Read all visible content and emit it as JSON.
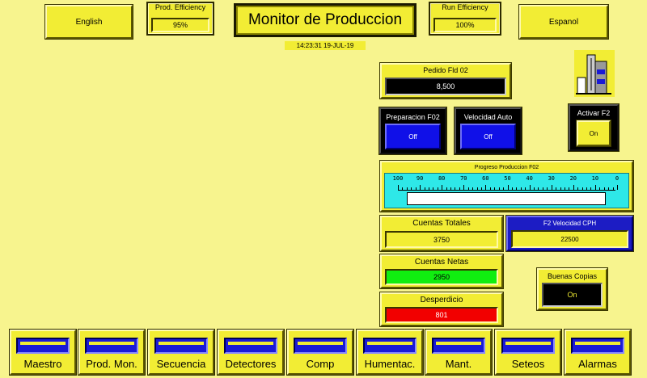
{
  "header": {
    "title": "Monitor de Produccion",
    "timestamp": "14:23:31 19-JUL-19",
    "english_label": "English",
    "espanol_label": "Espanol",
    "prod_efficiency": {
      "label": "Prod. Efficiency",
      "value": "95%"
    },
    "run_efficiency": {
      "label": "Run Efficiency",
      "value": "100%"
    }
  },
  "pedido": {
    "label": "Pedido Fld 02",
    "value": "8,500"
  },
  "preparacion": {
    "label": "Preparacion F02",
    "value": "Off"
  },
  "velocidad_auto": {
    "label": "Velocidad Auto",
    "value": "Off"
  },
  "activar": {
    "label": "Activar F2",
    "value": "On"
  },
  "progreso": {
    "label": "Progreso Produccion F02",
    "scale": [
      "100",
      "90",
      "80",
      "70",
      "60",
      "50",
      "40",
      "30",
      "20",
      "10",
      "0"
    ],
    "progress_fraction": 0
  },
  "cuentas_totales": {
    "label": "Cuentas Totales",
    "value": "3750"
  },
  "velocidad_cph": {
    "label": "F2 Velocidad CPH",
    "value": "22500"
  },
  "cuentas_netas": {
    "label": "Cuentas Netas",
    "value": "2950"
  },
  "desperdicio": {
    "label": "Desperdicio",
    "value": "801"
  },
  "buenas_copias": {
    "label": "Buenas Copias",
    "value": "On"
  },
  "nav": [
    {
      "label": "Maestro"
    },
    {
      "label": "Prod. Mon."
    },
    {
      "label": "Secuencia"
    },
    {
      "label": "Detectores"
    },
    {
      "label": "Comp"
    },
    {
      "label": "Humentac."
    },
    {
      "label": "Mant."
    },
    {
      "label": "Seteos"
    },
    {
      "label": "Alarmas"
    }
  ],
  "colors": {
    "background": "#f7f48e",
    "button": "#f2ed34",
    "blue": "#1c1cc4",
    "green": "#10ee10",
    "red": "#f20000",
    "gauge": "#2ee8e8"
  }
}
